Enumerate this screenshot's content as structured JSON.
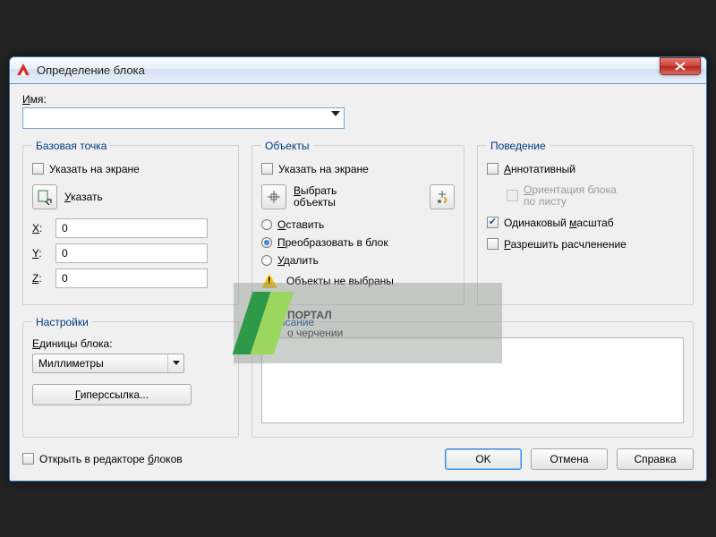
{
  "title": "Определение блока",
  "name_label_full": "Имя:",
  "name_value": "",
  "groups": {
    "base": {
      "legend": "Базовая точка",
      "specify_on_screen": "Указать на экране",
      "pick_btn": "Указать",
      "x_label": "X:",
      "x_val": "0",
      "y_label": "Y:",
      "y_val": "0",
      "z_label": "Z:",
      "z_val": "0"
    },
    "objects": {
      "legend": "Объекты",
      "specify_on_screen": "Указать на экране",
      "select_objects": "Выбрать объекты",
      "retain": "Оставить",
      "convert": "Преобразовать в блок",
      "delete": "Удалить",
      "no_objects": "Объекты не выбраны"
    },
    "behavior": {
      "legend": "Поведение",
      "annotative": "Аннотативный",
      "match_orient_l1": "Ориентация блока",
      "match_orient_l2": "по листу",
      "uniform_scale": "Одинаковый масштаб",
      "allow_explode": "Разрешить расчленение"
    },
    "settings": {
      "legend": "Настройки",
      "units_label": "Единицы блока:",
      "units_value": "Миллиметры",
      "hyperlink": "Гиперссылка..."
    },
    "description": {
      "legend": "Описание",
      "value": ""
    }
  },
  "open_in_editor": "Открыть в редакторе блоков",
  "buttons": {
    "ok": "OK",
    "cancel": "Отмена",
    "help": "Справка"
  },
  "watermark": {
    "line1": "ПОРТАЛ",
    "line2": "о черчении"
  }
}
